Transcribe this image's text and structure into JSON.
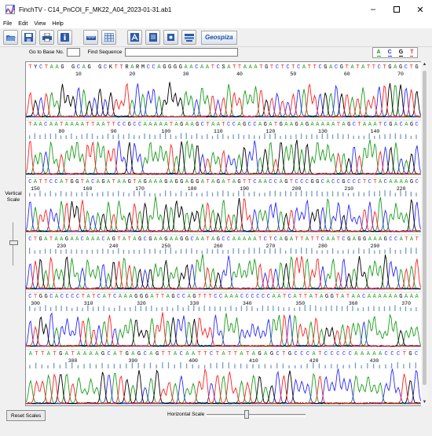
{
  "window": {
    "title": "FinchTV - C14_PnCOI_F_MK22_A04_2023-01-31.ab1"
  },
  "menu": [
    "File",
    "Edit",
    "View",
    "Help"
  ],
  "toolbar": {
    "buttons": [
      "open-icon",
      "save-icon",
      "print-icon",
      "info-icon",
      "ruler-icon",
      "grid-icon",
      "font-a-icon",
      "document-icon",
      "chip-icon",
      "stack-icon"
    ],
    "brand": "Geospiza"
  },
  "search": {
    "goto_label": "Go to Base No.",
    "goto_value": "",
    "find_label": "Find Sequence",
    "find_value": ""
  },
  "legend": [
    {
      "base": "A",
      "color": "#1b9c1b"
    },
    {
      "base": "C",
      "color": "#2a2aff"
    },
    {
      "base": "G",
      "color": "#000000"
    },
    {
      "base": "T",
      "color": "#ff2020"
    }
  ],
  "vertical_scale_label": "Vertical Scale",
  "bottom": {
    "reset_label": "Reset Scales",
    "horizontal_label": "Horizontal Scale"
  },
  "sequence_rows": [
    {
      "seq": "TYCTAAG GCAG GCKTTRARMCCAGGGGAACAATCSATTAAATGTCTCTCATTCGACGTATATTCTGAGCTG",
      "ticks": [
        10,
        20,
        30,
        40,
        50,
        60,
        70
      ]
    },
    {
      "seq": "TAACAATAAAATTAATTCCGCCAAAAATAGAAGCTAATCCAGCCAGATGAAGAGAAAAATAGCTAAATCGACAGC",
      "ticks": [
        80,
        90,
        100,
        110,
        120,
        130,
        140
      ]
    },
    {
      "seq": "CATTCCATGGTACAGATAAGTAGAAAGAGGAGGATAGATAGTTCAACCAGTCCCGGCACCGCCCTCTACAAAAGC",
      "ticks": [
        150,
        160,
        170,
        180,
        190,
        200,
        210,
        220
      ]
    },
    {
      "seq": "CTGATAAGAACAAACAGTATAGCGAAGAAGGCAATAGCCAAAAATCTCAGATTATTCAATCGAGGAAAGCCATAT",
      "ticks": [
        230,
        240,
        250,
        260,
        270,
        280,
        290
      ]
    },
    {
      "seq": "CTGGCACCCCTATCATCAAAGGGATTAGCCAGTTTCCAAACCCCCCAATCATTATAGGTATAACAAAAAAGAAA",
      "ticks": [
        300,
        310,
        320,
        330,
        340,
        350,
        360,
        370
      ]
    },
    {
      "seq": "ATTATGATAAAAGCATGAGCAGTTACAATTCTATTATAGAGCTGCCCATCCCCCAAAAACCCTGC",
      "ticks": [
        380,
        390,
        400,
        410,
        420,
        430
      ]
    }
  ]
}
